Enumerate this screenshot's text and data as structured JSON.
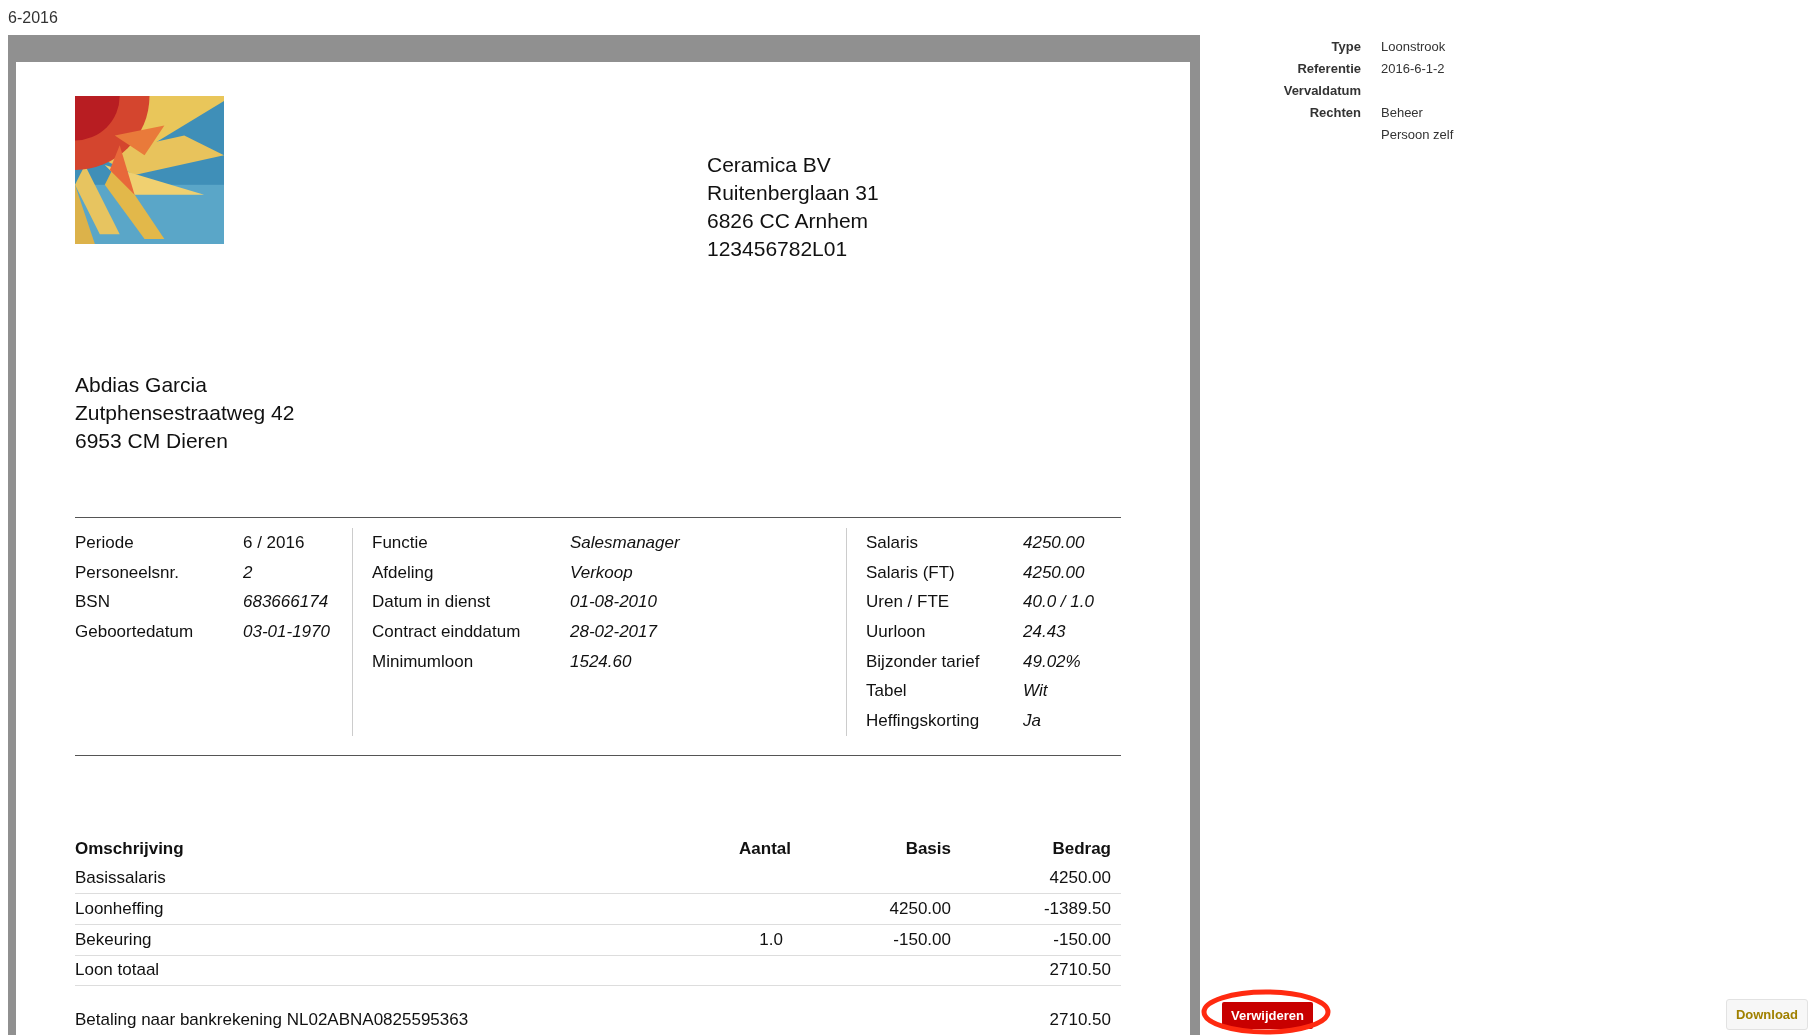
{
  "page_title": "6-2016",
  "document": {
    "logo": {
      "kind": "picture"
    },
    "company": [
      "Ceramica BV",
      "Ruitenberglaan 31",
      "6826 CC Arnhem",
      "123456782L01"
    ],
    "employee": [
      "Abdias Garcia",
      "Zutphensestraatweg 42",
      "6953 CM Dieren"
    ],
    "info_sections": [
      [
        {
          "label": "Periode",
          "value": "6 / 2016",
          "italic": false
        },
        {
          "label": "Personeelsnr.",
          "value": "2",
          "italic": true
        },
        {
          "label": "BSN",
          "value": "683666174",
          "italic": true
        },
        {
          "label": "Geboortedatum",
          "value": "03-01-1970",
          "italic": true
        }
      ],
      [
        {
          "label": "Functie",
          "value": "Salesmanager",
          "italic": true
        },
        {
          "label": "Afdeling",
          "value": "Verkoop",
          "italic": true
        },
        {
          "label": "Datum in dienst",
          "value": "01-08-2010",
          "italic": true
        },
        {
          "label": "Contract einddatum",
          "value": "28-02-2017",
          "italic": true
        },
        {
          "label": "Minimumloon",
          "value": "1524.60",
          "italic": true
        }
      ],
      [
        {
          "label": "Salaris",
          "value": "4250.00",
          "italic": true
        },
        {
          "label": "Salaris (FT)",
          "value": "4250.00",
          "italic": true
        },
        {
          "label": "Uren / FTE",
          "value": "40.0 / 1.0",
          "italic": true
        },
        {
          "label": "Uurloon",
          "value": "24.43",
          "italic": true
        },
        {
          "label": "Bijzonder tarief",
          "value": "49.02%",
          "italic": true
        },
        {
          "label": "Tabel",
          "value": "Wit",
          "italic": true
        },
        {
          "label": "Heffingskorting",
          "value": "Ja",
          "italic": true
        }
      ]
    ],
    "table": {
      "columns": [
        "Omschrijving",
        "Aantal",
        "Basis",
        "Bedrag"
      ],
      "rows": [
        [
          "Basissalaris",
          "",
          "",
          "4250.00"
        ],
        [
          "Loonheffing",
          "",
          "4250.00",
          "-1389.50"
        ],
        [
          "Bekeuring",
          "1.0",
          "-150.00",
          "-150.00"
        ],
        [
          "Loon totaal",
          "",
          "",
          "2710.50"
        ]
      ]
    },
    "payment": {
      "text": "Betaling naar bankrekening NL02ABNA0825595363",
      "amount": "2710.50"
    }
  },
  "details": [
    {
      "label": "Type",
      "values": [
        "Loonstrook"
      ]
    },
    {
      "label": "Referentie",
      "values": [
        "2016-6-1-2"
      ]
    },
    {
      "label": "Vervaldatum"
    },
    {
      "label": "Rechten",
      "values": [
        "Beheer",
        "Persoon zelf"
      ]
    }
  ],
  "buttons": {
    "delete": "Verwijderen",
    "download": "Download"
  },
  "annotation": {
    "kind": "ellipse"
  }
}
